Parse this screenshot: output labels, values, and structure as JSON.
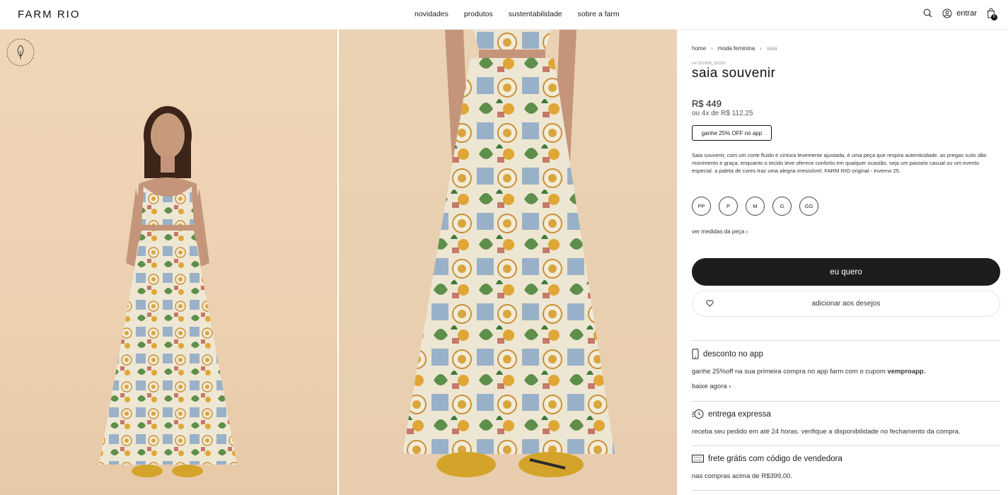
{
  "header": {
    "logo": "FARM RIO",
    "nav": [
      "novidades",
      "produtos",
      "sustentabilidade",
      "sobre a farm"
    ],
    "login_label": "entrar",
    "bag_count": "0"
  },
  "breadcrumb": [
    "home",
    "moda feminina",
    "saia"
  ],
  "product": {
    "ref": "ref 337805_50332",
    "title": "saia souvenir",
    "price": "R$ 449",
    "installments": "ou 4x de R$ 112,25",
    "promo_button": "ganhe 25% OFF no app",
    "description": "Saia souvenir, com um corte fluido e cintura levemente ajustada, é uma peça que respira autenticidade. as pregas sutis dão movimento e graça, enquanto o tecido leve oferece conforto em qualquer ocasião, seja um passeio casual ou um evento especial. a paleta de cores traz uma alegria irresistível. FARM RIO original - inverno 25.",
    "sizes": [
      "PP",
      "P",
      "M",
      "G",
      "GG"
    ],
    "measures_link": "ver medidas da peça",
    "buy_button": "eu quero",
    "wishlist_button": "adicionar aos desejos"
  },
  "info": {
    "app": {
      "title": "desconto no app",
      "text_prefix": "ganhe 25%off na sua primeira compra no app farm com o cupom ",
      "coupon": "vemproapp.",
      "link": "baixe agora"
    },
    "express": {
      "title": "entrega expressa",
      "text": "receba seu pedido em até 24 horas. verifique a disponibilidade no fechamento da compra."
    },
    "shipping": {
      "title": "frete grátis com código de vendedora",
      "text": "nas compras acima de R$399,00."
    }
  },
  "colors": {
    "accent": "#1d1d1d",
    "background": "#ffffff",
    "photo_bg": "#ecd1b1"
  }
}
